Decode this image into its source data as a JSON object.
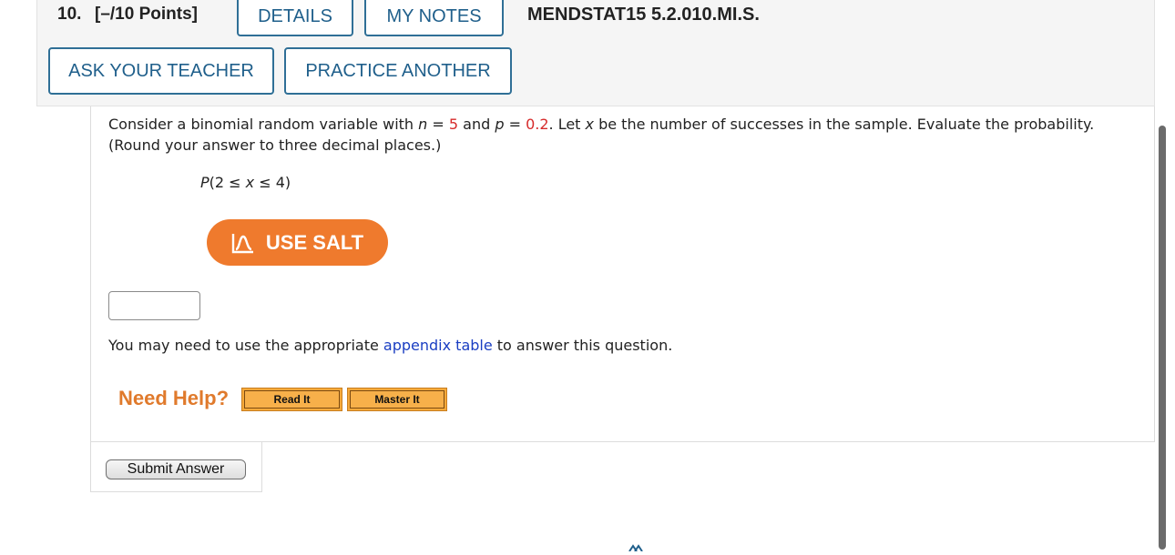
{
  "header": {
    "question_number": "10.",
    "points": "[–/10 Points]",
    "details_label": "DETAILS",
    "my_notes_label": "MY NOTES",
    "question_code": "MENDSTAT15 5.2.010.MI.S.",
    "ask_teacher_label": "ASK YOUR TEACHER",
    "practice_another_label": "PRACTICE ANOTHER"
  },
  "question": {
    "text_part1": "Consider a binomial random variable with ",
    "n_var": "n",
    "eq1": " = ",
    "n_value": "5",
    "and": " and ",
    "p_var": "p",
    "eq2": " = ",
    "p_value": "0.2",
    "text_part2": ". Let ",
    "x_var": "x",
    "text_part3": " be the number of successes in the sample. Evaluate the probability. (Round your answer to three decimal places.)",
    "expression_p": "P",
    "expression_rest": "(2 ≤ ",
    "expression_x": "x",
    "expression_end": " ≤ 4)"
  },
  "salt": {
    "label": "USE SALT"
  },
  "answer": {
    "value": ""
  },
  "appendix": {
    "before": "You may need to use the appropriate ",
    "link": "appendix table",
    "after": " to answer this question."
  },
  "help": {
    "label": "Need Help?",
    "read_it": "Read It",
    "master_it": "Master It"
  },
  "submit": {
    "label": "Submit Answer"
  },
  "colors": {
    "accent_blue": "#1f5f8b",
    "salt_orange": "#ef7a2d",
    "value_red": "#d62a2a",
    "link_blue": "#1a3ec2",
    "help_orange": "#e07a2c"
  }
}
